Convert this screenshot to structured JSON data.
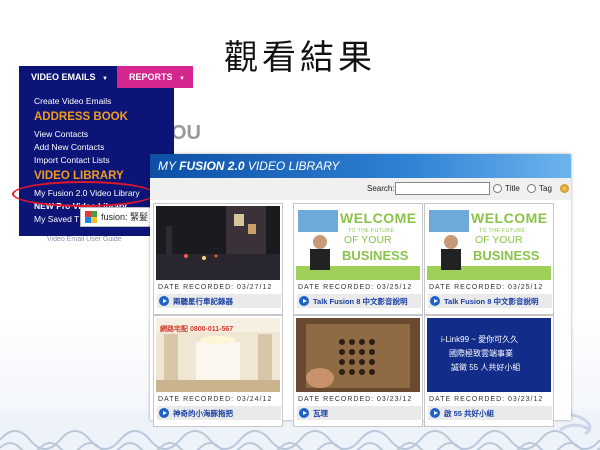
{
  "slide": {
    "title": "觀看結果"
  },
  "menu": {
    "tab_video_emails": "VIDEO EMAILS",
    "tab_reports": "REPORTS",
    "caret": "▼",
    "items": [
      {
        "label": "Create Video Emails",
        "kind": "item"
      },
      {
        "label": "ADDRESS BOOK",
        "kind": "heading"
      },
      {
        "label": "View Contacts",
        "kind": "item"
      },
      {
        "label": "Add New Contacts",
        "kind": "item"
      },
      {
        "label": "Import Contact Lists",
        "kind": "item"
      },
      {
        "label": "VIDEO LIBRARY",
        "kind": "heading"
      },
      {
        "label": "My Fusion 2.0 Video Library",
        "kind": "item"
      },
      {
        "label": "NEW Pro Video Library",
        "kind": "item"
      },
      {
        "label": "My Saved T",
        "kind": "item"
      }
    ],
    "fusion_chip": "fusion: 緊髮",
    "ghost_text": "OU",
    "ghost_link": "Video Email User Guide",
    "accent": "#0c1577",
    "reports_color": "#d5268f",
    "heading_color": "#f29b1c",
    "highlight_color": "#e0162b"
  },
  "library": {
    "title_prefix": "MY",
    "title_brand": "FUSION 2.0",
    "title_suffix": "VIDEO LIBRARY",
    "search_label": "Search:",
    "search_value": "",
    "radio_title": "Title",
    "radio_tag": "Tag",
    "tiles": [
      {
        "date": "DATE RECORDED: 03/27/12",
        "caption": "兩聽星行車記錄器",
        "thumb": "night-street"
      },
      {
        "date": "DATE RECORDED: 03/25/12",
        "caption": "Talk Fusion 8 中文影音說明",
        "thumb": "welcome"
      },
      {
        "date": "DATE RECORDED: 03/25/12",
        "caption": "Talk Fusion 8 中文影音說明",
        "thumb": "welcome"
      },
      {
        "date": "DATE RECORDED: 03/24/12",
        "caption": "神奇的小海豚拖把",
        "thumb": "room"
      },
      {
        "date": "DATE RECORDED: 03/23/12",
        "caption": "瓦理",
        "thumb": "board"
      },
      {
        "date": "DATE RECORDED: 03/23/12",
        "caption": "啟 55 共好小組",
        "thumb": "ad"
      }
    ],
    "welcome": {
      "line1": "WELCOME",
      "line2": "TO THE FUTURE",
      "line3": "OF YOUR",
      "line4": "BUSINESS"
    },
    "room_banner": "網路宅配 0800-011-567",
    "ad_lines": [
      "i-Link99 ~ 愛你可久久",
      "國際極致雲端事業",
      "誠徵 55 人共好小組"
    ]
  }
}
